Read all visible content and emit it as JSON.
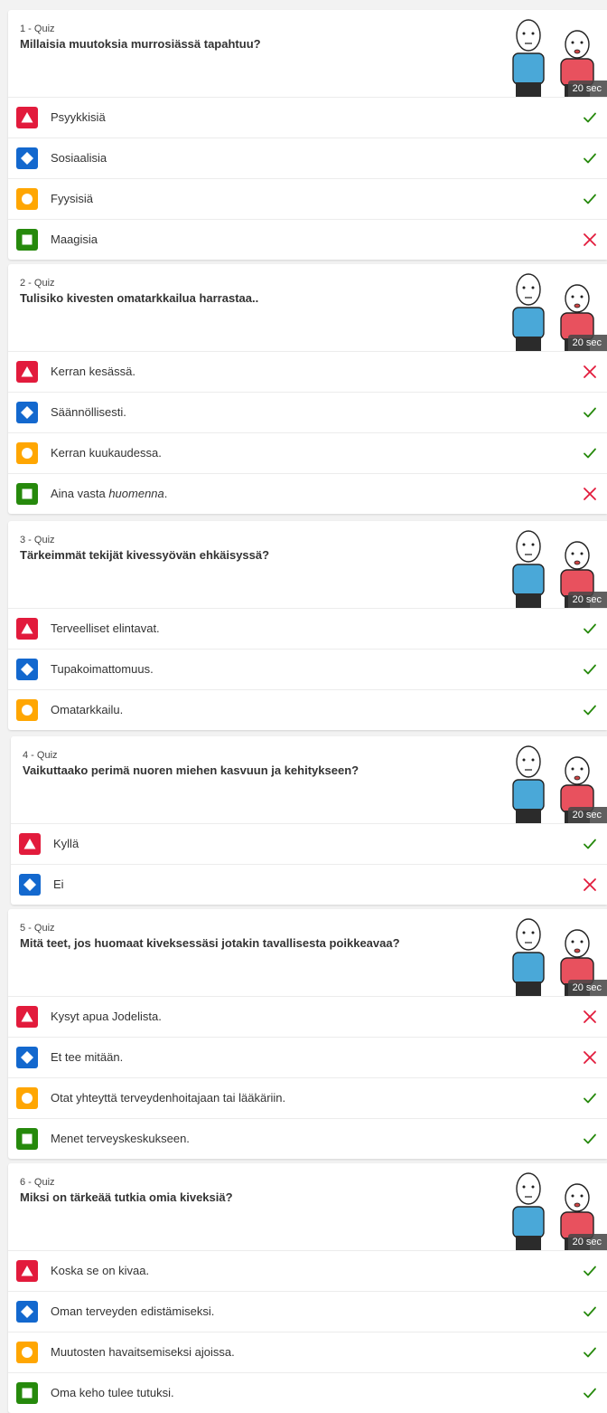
{
  "quiz": {
    "shape_colors": {
      "triangle": "#e21b3c",
      "diamond": "#1368ce",
      "circle": "#ffa602",
      "square": "#26890c"
    },
    "mark_colors": {
      "correct": "#26890c",
      "incorrect": "#e21b3c"
    },
    "questions": [
      {
        "label": "1 - Quiz",
        "title": "Millaisia muutoksia murrosiässä tapahtuu?",
        "time": "20 sec",
        "answers": [
          {
            "shape": "triangle",
            "text": "Psyykkisiä",
            "correct": true
          },
          {
            "shape": "diamond",
            "text": "Sosiaalisia",
            "correct": true
          },
          {
            "shape": "circle",
            "text": "Fyysisiä",
            "correct": true
          },
          {
            "shape": "square",
            "text": "Maagisia",
            "correct": false
          }
        ]
      },
      {
        "label": "2 - Quiz",
        "title": "Tulisiko kivesten omatarkkailua harrastaa..",
        "time": "20 sec",
        "answers": [
          {
            "shape": "triangle",
            "text": "Kerran kesässä.",
            "correct": false
          },
          {
            "shape": "diamond",
            "text": "Säännöllisesti.",
            "correct": true
          },
          {
            "shape": "circle",
            "text": "Kerran kuukaudessa.",
            "correct": true
          },
          {
            "shape": "square",
            "text": "Aina vasta ",
            "italic": "huomenna",
            "suffix": ".",
            "correct": false
          }
        ]
      },
      {
        "label": "3 - Quiz",
        "title": "Tärkeimmät tekijät kivessyövän ehkäisyssä?",
        "time": "20 sec",
        "answers": [
          {
            "shape": "triangle",
            "text": "Terveelliset elintavat.",
            "correct": true
          },
          {
            "shape": "diamond",
            "text": "Tupakoimattomuus.",
            "correct": true
          },
          {
            "shape": "circle",
            "text": "Omatarkkailu.",
            "correct": true
          }
        ]
      },
      {
        "label": "4 - Quiz",
        "title": "Vaikuttaako perimä nuoren miehen kasvuun ja kehitykseen?",
        "time": "20 sec",
        "answers": [
          {
            "shape": "triangle",
            "text": "Kyllä",
            "correct": true
          },
          {
            "shape": "diamond",
            "text": "Ei",
            "correct": false
          }
        ]
      },
      {
        "label": "5 - Quiz",
        "title": "Mitä teet, jos huomaat kiveksessäsi jotakin tavallisesta poikkeavaa?",
        "time": "20 sec",
        "answers": [
          {
            "shape": "triangle",
            "text": "Kysyt apua Jodelista.",
            "correct": false
          },
          {
            "shape": "diamond",
            "text": "Et tee mitään.",
            "correct": false
          },
          {
            "shape": "circle",
            "text": "Otat yhteyttä terveydenhoitajaan tai lääkäriin.",
            "correct": true
          },
          {
            "shape": "square",
            "text": "Menet terveyskeskukseen.",
            "correct": true
          }
        ]
      },
      {
        "label": "6 - Quiz",
        "title": "Miksi on tärkeää tutkia omia kiveksiä?",
        "time": "20 sec",
        "answers": [
          {
            "shape": "triangle",
            "text": "Koska se on kivaa.",
            "correct": true
          },
          {
            "shape": "diamond",
            "text": "Oman terveyden edistämiseksi.",
            "correct": true
          },
          {
            "shape": "circle",
            "text": "Muutosten havaitsemiseksi ajoissa.",
            "correct": true
          },
          {
            "shape": "square",
            "text": "Oma keho tulee tutuksi.",
            "correct": true
          }
        ]
      }
    ]
  }
}
